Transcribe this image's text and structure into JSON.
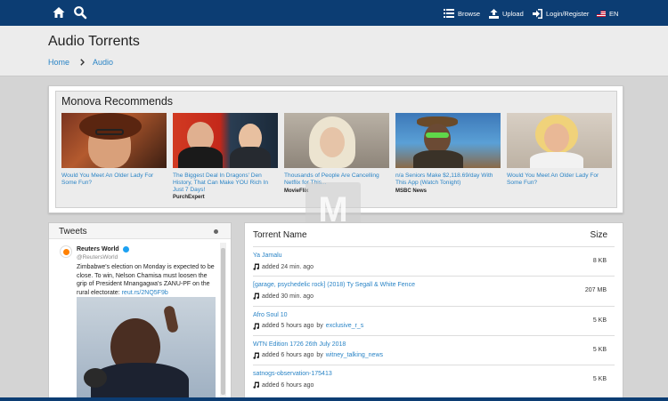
{
  "nav": {
    "browse": "Browse",
    "upload": "Upload",
    "login": "Login/Register",
    "lang": "EN"
  },
  "header": {
    "title": "Audio Torrents",
    "breadcrumb": [
      "Home",
      "Audio"
    ]
  },
  "recommend": {
    "title": "Monova Recommends",
    "items": [
      {
        "text": "Would You Meet An Older Lady For Some Fun?",
        "source": ""
      },
      {
        "text": "The Biggest Deal In Dragons' Den History, That Can Make YOU Rich In Just 7 Days!",
        "source": "PurchExpert"
      },
      {
        "text": "Thousands of People Are Cancelling Netflix for This...",
        "source": "MovieFlix"
      },
      {
        "text": "n/a Seniors Make $2,118.69/day With This App (Watch Tonight)",
        "source": "MSBC News"
      },
      {
        "text": "Would You Meet An Older Lady For Some Fun?",
        "source": ""
      }
    ]
  },
  "tweets": {
    "title": "Tweets",
    "name": "Reuters World",
    "handle": "@ReutersWorld",
    "body": "Zimbabwe's election on Monday is expected to be close. To win, Nelson Chamisa must loosen the grip of President Mnangagwa's ZANU-PF on the rural electorate:",
    "link": "reut.rs/2NQ5F9b"
  },
  "table": {
    "col_name": "Torrent Name",
    "col_size": "Size",
    "rows": [
      {
        "name": "Ya Jamalu",
        "added": "added 24 min. ago",
        "by": "",
        "user": "",
        "size": "8 KB"
      },
      {
        "name": "[garage, psychedelic rock] (2018) Ty Segall & White Fence",
        "added": "added 30 min. ago",
        "by": "",
        "user": "",
        "size": "207 MB"
      },
      {
        "name": "Afro Soul 10",
        "added": "added 5 hours ago",
        "by": "by",
        "user": "exclusive_r_s",
        "size": "5 KB"
      },
      {
        "name": "WTN Edition 1726 26th July 2018",
        "added": "added 6 hours ago",
        "by": "by",
        "user": "witney_talking_news",
        "size": "5 KB"
      },
      {
        "name": "satnogs-observation-175413",
        "added": "added 6 hours ago",
        "by": "",
        "user": "",
        "size": "5 KB"
      }
    ]
  },
  "colors": {
    "nav": "#0c3d73",
    "link": "#2a84c6"
  },
  "icons": [
    "home-icon",
    "search-icon",
    "browse-icon",
    "upload-icon",
    "login-icon",
    "flag-icon",
    "music-note-icon",
    "verified-icon",
    "info-icon"
  ]
}
